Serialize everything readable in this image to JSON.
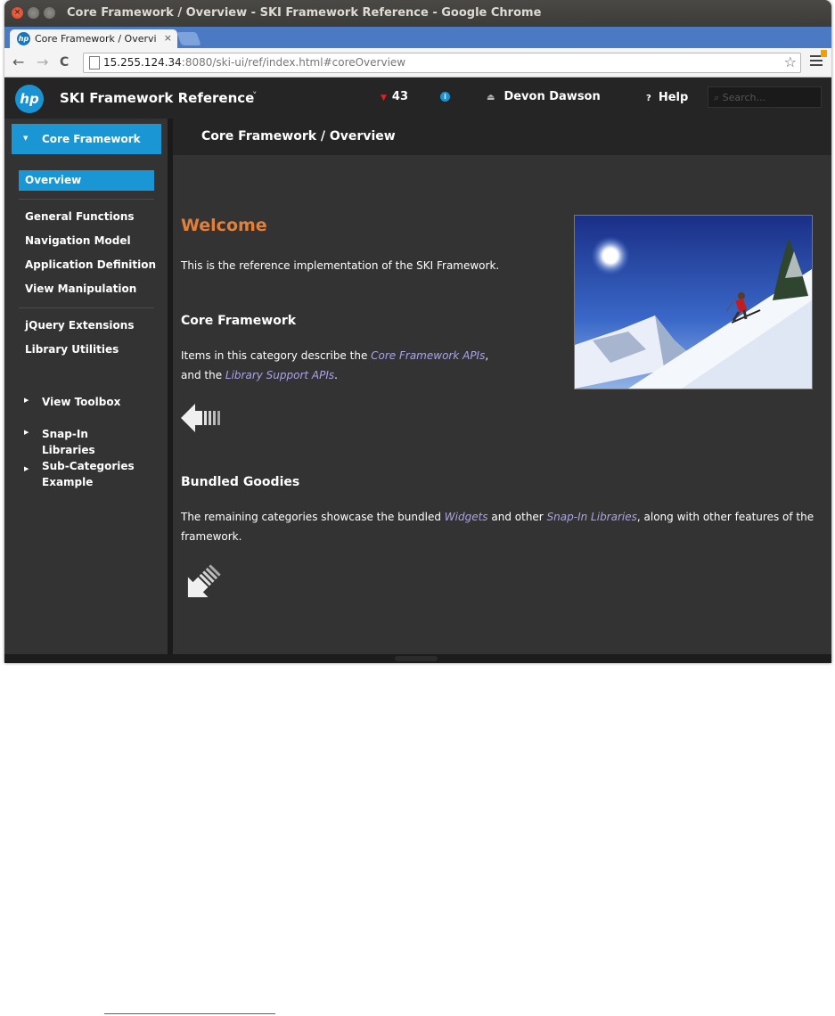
{
  "window": {
    "title": "Core Framework / Overview - SKI Framework Reference - Google Chrome"
  },
  "tab": {
    "title": "Core Framework / Overvi",
    "close": "×",
    "favicon": "hp"
  },
  "toolbar": {
    "url_host": "15.255.124.34",
    "url_rest": ":8080/ski-ui/ref/index.html#coreOverview",
    "back": "←",
    "forward": "→",
    "reload": "C",
    "star": "☆"
  },
  "header": {
    "logo": "hp",
    "app_title": "SKI Framework Reference",
    "dropdown": "˅",
    "alert_count": "43",
    "info": "i",
    "user_name": "Devon Dawson",
    "help": "Help",
    "help_icon": "?",
    "search_placeholder": "Search..."
  },
  "sidebar": {
    "active_section": "Core Framework",
    "selected_item": "Overview",
    "items_group1": [
      "General Functions",
      "Navigation Model",
      "Application Definition",
      "View Manipulation"
    ],
    "items_group2": [
      "jQuery Extensions",
      "Library Utilities"
    ],
    "groups": [
      "View Toolbox",
      "Snap-In Libraries",
      "Sub-Categories Example"
    ]
  },
  "main": {
    "breadcrumb_title": "Core Framework / Overview",
    "welcome": "Welcome",
    "intro": "This is the reference implementation of the SKI Framework.",
    "core_heading": "Core Framework",
    "core_text_1": "Items in this category describe the ",
    "core_link_1": "Core Framework APIs",
    "core_text_2": ",",
    "core_text_3": "and the ",
    "core_link_2": "Library Support APIs",
    "core_text_4": ".",
    "bundled_heading": "Bundled Goodies",
    "bundled_text_1": "The remaining categories showcase the bundled ",
    "bundled_link_1": "Widgets",
    "bundled_text_2": " and other ",
    "bundled_link_2": "Snap-In Libraries",
    "bundled_text_3": ", along with other features of the framework."
  },
  "colors": {
    "accent": "#1b96d5",
    "welcome": "#e0803a",
    "link": "#a9a4e8",
    "header_bg": "#252525",
    "panel_bg": "#333333"
  }
}
